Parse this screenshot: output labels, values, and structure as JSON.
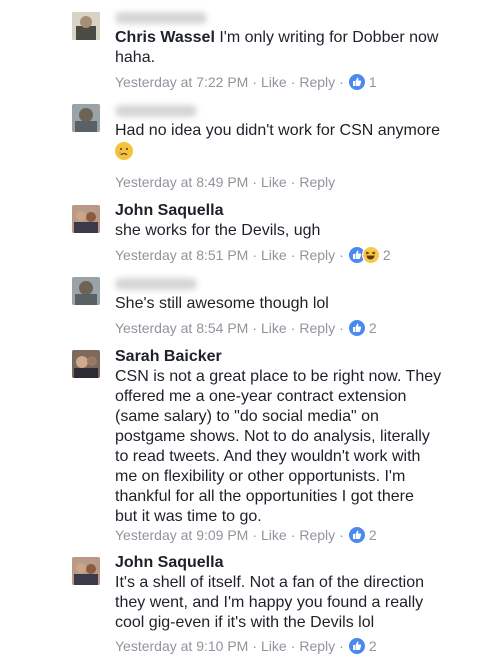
{
  "comments": [
    {
      "author": "Chris Wassel",
      "lines": [
        "I'm only writing for Dobber now",
        "haha."
      ],
      "time": "Yesterday at 7:22 PM",
      "like_label": "Like",
      "reply_label": "Reply",
      "reactions": [
        "like"
      ],
      "reaction_count": "1"
    },
    {
      "author": "",
      "lines": [
        "Had no idea you didn't work for CSN anymore"
      ],
      "emoji": "crying-face",
      "time": "Yesterday at 8:49 PM",
      "like_label": "Like",
      "reply_label": "Reply"
    },
    {
      "author": "John Saquella",
      "lines": [
        "she works for the Devils, ugh"
      ],
      "time": "Yesterday at 8:51 PM",
      "like_label": "Like",
      "reply_label": "Reply",
      "reactions": [
        "like",
        "haha"
      ],
      "reaction_count": "2"
    },
    {
      "author": "",
      "lines": [
        "She's still awesome though lol"
      ],
      "time": "Yesterday at 8:54 PM",
      "like_label": "Like",
      "reply_label": "Reply",
      "reactions": [
        "like"
      ],
      "reaction_count": "2"
    },
    {
      "author": "Sarah Baicker",
      "lines": [
        "CSN is not a great place to be right now. They",
        "offered me a one-year contract extension",
        "(same salary) to \"do social media\" on",
        "postgame shows. Not to do analysis, literally",
        "to read tweets. And they wouldn't work with",
        "me on flexibility or other opportunists. I'm",
        "thankful for all the opportunities I got there",
        "but it was time to go."
      ],
      "time": "Yesterday at 9:09 PM",
      "like_label": "Like",
      "reply_label": "Reply",
      "reactions": [
        "like"
      ],
      "reaction_count": "2"
    },
    {
      "author": "John Saquella",
      "lines": [
        "It's a shell of itself. Not a fan of the direction",
        "they went, and I'm happy you found a really",
        "cool gig-even if it's with the Devils lol"
      ],
      "time": "Yesterday at 9:10 PM",
      "like_label": "Like",
      "reply_label": "Reply",
      "reactions": [
        "like"
      ],
      "reaction_count": "2"
    }
  ],
  "colors": {
    "like_blue": "#4a8af0",
    "meta_gray": "#90949c",
    "text": "#1d2129"
  }
}
